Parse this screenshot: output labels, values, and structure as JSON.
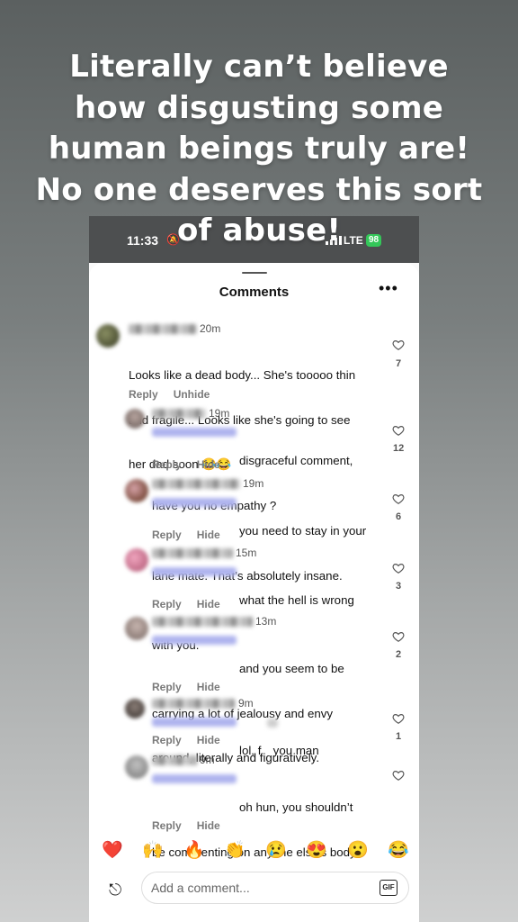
{
  "caption": {
    "line1": "Literally can’t believe",
    "line2": "how disgusting some",
    "line3": "human beings truly are!",
    "line4": "No one deserves this sort",
    "line5": "of abuse!"
  },
  "status_bar": {
    "time": "11:33",
    "network": "LTE",
    "battery": "98"
  },
  "sheet": {
    "title": "Comments",
    "more_icon": "more-horizontal-icon"
  },
  "actions": {
    "reply": "Reply",
    "hide": "Hide",
    "unhide": "Unhide"
  },
  "comments": [
    {
      "time": "20m",
      "text": [
        "Looks like a dead body... She's tooooo thin",
        "and fragile... Looks like she's going to see",
        "her dad soon 😂😂"
      ],
      "likes": "7"
    },
    {
      "time": "19m",
      "text": [
        "disgraceful comment,",
        "have you no empathy ?"
      ],
      "likes": "12"
    },
    {
      "time": "19m",
      "text": [
        "you need to stay in your",
        "lane mate. That’s absolutely insane."
      ],
      "likes": "6"
    },
    {
      "time": "15m",
      "text": [
        "what the hell is wrong",
        "with you."
      ],
      "likes": "3"
    },
    {
      "time": "13m",
      "text": [
        "and you seem to be",
        "carrying a lot of jealousy and envy",
        "around, literally and figuratively."
      ],
      "likes": "2"
    },
    {
      "time": "9m",
      "text": [
        "lol, f you man"
      ],
      "likes": "1"
    },
    {
      "time": "9m",
      "text": [
        "oh hun, you shouldn’t",
        "be commenting on anyone else’s body.",
        "😂"
      ],
      "likes": ""
    }
  ],
  "reactions": [
    "❤️",
    "🙌",
    "🔥",
    "👏",
    "😢",
    "😍",
    "😮",
    "😂"
  ],
  "composer": {
    "placeholder": "Add a comment...",
    "gif_label": "GIF",
    "icon": "reply-arrow-icon"
  },
  "colors": {
    "like_heart": "#555555",
    "mention_blur": "#aeb3ee",
    "battery": "#34c759"
  }
}
